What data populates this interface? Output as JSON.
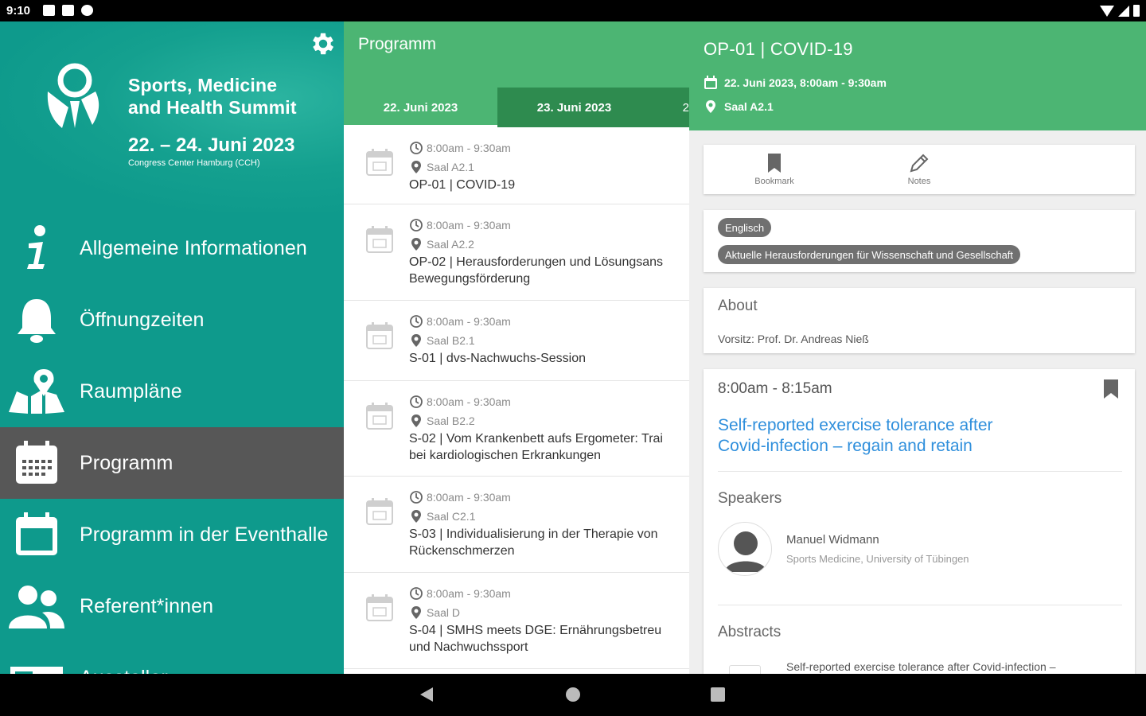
{
  "status_bar": {
    "time": "9:10"
  },
  "drawer": {
    "brand_line1": "Sports, Medicine",
    "brand_line2": "and Health Summit",
    "dates": "22. – 24. Juni 2023",
    "venue": "Congress Center Hamburg (CCH)",
    "items": [
      {
        "label": "Allgemeine Informationen",
        "icon": "info-icon"
      },
      {
        "label": "Öffnungzeiten",
        "icon": "bell-icon"
      },
      {
        "label": "Raumpläne",
        "icon": "map-icon"
      },
      {
        "label": "Programm",
        "icon": "calendar-grid-icon",
        "active": true
      },
      {
        "label": "Programm in der Eventhalle",
        "icon": "calendar-icon"
      },
      {
        "label": "Referent*innen",
        "icon": "people-icon"
      },
      {
        "label": "Aussteller",
        "icon": "book-icon"
      }
    ]
  },
  "programm": {
    "title": "Programm",
    "tabs": [
      "22. Juni 2023",
      "23. Juni 2023",
      "2"
    ],
    "sessions": [
      {
        "time": "8:00am - 9:30am",
        "room": "Saal A2.1",
        "title_line1": "OP-01 | COVID-19",
        "title_line2": ""
      },
      {
        "time": "8:00am - 9:30am",
        "room": "Saal A2.2",
        "title_line1": "OP-02 | Herausforderungen und Lösungsans",
        "title_line2": "Bewegungsförderung"
      },
      {
        "time": "8:00am - 9:30am",
        "room": "Saal B2.1",
        "title_line1": "S-01 | dvs-Nachwuchs-Session",
        "title_line2": ""
      },
      {
        "time": "8:00am - 9:30am",
        "room": "Saal B2.2",
        "title_line1": "S-02 | Vom Krankenbett aufs Ergometer: Trai",
        "title_line2": "bei kardiologischen Erkrankungen"
      },
      {
        "time": "8:00am - 9:30am",
        "room": "Saal C2.1",
        "title_line1": "S-03 | Individualisierung in der Therapie von",
        "title_line2": "Rückenschmerzen"
      },
      {
        "time": "8:00am - 9:30am",
        "room": "Saal D",
        "title_line1": "S-04 | SMHS meets DGE: Ernährungsbetreu",
        "title_line2": "und Nachwuchssport"
      }
    ]
  },
  "detail": {
    "title": "OP-01 | COVID-19",
    "datetime": "22. Juni 2023, 8:00am - 9:30am",
    "room": "Saal A2.1",
    "actions": {
      "bookmark": "Bookmark",
      "notes": "Notes"
    },
    "chips": [
      "Englisch",
      "Aktuelle Herausforderungen für Wissenschaft und Gesellschaft"
    ],
    "about_title": "About",
    "about_text": "Vorsitz:  Prof. Dr. Andreas Nieß",
    "slot_time": "8:00am - 8:15am",
    "talk_title_line1": "Self-reported exercise tolerance after",
    "talk_title_line2": "Covid-infection – regain and retain",
    "speakers_title": "Speakers",
    "speaker_name": "Manuel Widmann",
    "speaker_affiliation": "Sports Medicine, University of Tübingen",
    "abstracts_title": "Abstracts",
    "abstract_text": "Self-reported exercise tolerance after Covid-infection –"
  },
  "colors": {
    "drawer": "#0e9a8c",
    "active_item": "#575757",
    "header_green": "#4cb573",
    "tab_dark": "#2e8b4f",
    "link_blue": "#2f8fdc"
  }
}
